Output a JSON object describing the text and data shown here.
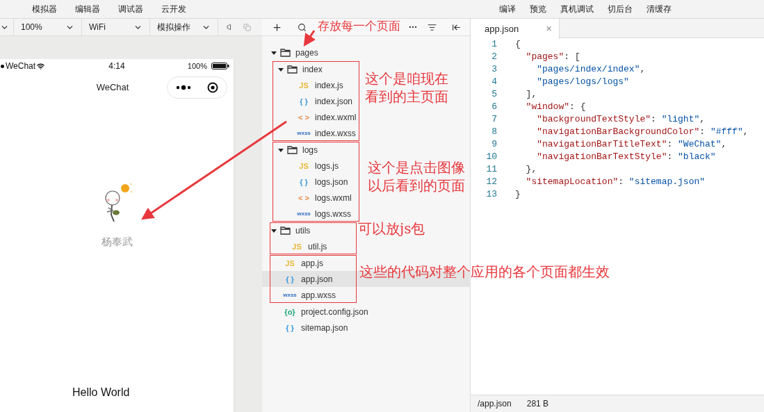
{
  "menu": {
    "left": [
      "模拟器",
      "编辑器",
      "调试器",
      "云开发"
    ],
    "right": [
      "编译",
      "预览",
      "真机调试",
      "切后台",
      "清缓存"
    ]
  },
  "simulator_toolbar": {
    "dropdowns": [
      "100%",
      "WiFi",
      "模拟操作"
    ]
  },
  "phone": {
    "carrier": "WeChat",
    "time": "4:14",
    "battery": "100%",
    "title": "WeChat",
    "username": "杨奉武",
    "greeting": "Hello World"
  },
  "callout": "存放每一个页面",
  "tree": [
    {
      "kind": "folder",
      "name": "pages",
      "expanded": true,
      "boxed": false,
      "children": [
        {
          "kind": "folder",
          "name": "index",
          "expanded": true,
          "boxed": true,
          "note": [
            "这个是咱现在",
            "看到的主页面"
          ],
          "children": [
            {
              "kind": "js",
              "icon": "JS",
              "name": "index.js",
              "selected": false
            },
            {
              "kind": "json",
              "icon": "{ }",
              "name": "index.json",
              "selected": false
            },
            {
              "kind": "wxml",
              "icon": "< >",
              "name": "index.wxml",
              "selected": false
            },
            {
              "kind": "wxss",
              "icon": "wxss",
              "name": "index.wxss",
              "selected": false
            }
          ]
        },
        {
          "kind": "folder",
          "name": "logs",
          "expanded": true,
          "boxed": true,
          "note": [
            "这个是点击图像",
            "以后看到的页面"
          ],
          "children": [
            {
              "kind": "js",
              "icon": "JS",
              "name": "logs.js",
              "selected": false
            },
            {
              "kind": "json",
              "icon": "{ }",
              "name": "logs.json",
              "selected": false
            },
            {
              "kind": "wxml",
              "icon": "< >",
              "name": "logs.wxml",
              "selected": false
            },
            {
              "kind": "wxss",
              "icon": "wxss",
              "name": "logs.wxss",
              "selected": false
            }
          ]
        }
      ]
    },
    {
      "kind": "folder",
      "name": "utils",
      "expanded": true,
      "boxed": true,
      "note": [
        "可以放js包"
      ],
      "children": [
        {
          "kind": "js",
          "icon": "JS",
          "name": "util.js",
          "selected": false
        }
      ]
    },
    {
      "kind": "group",
      "boxed": true,
      "note": [
        "这些的代码对整个应用的各个页面都生效"
      ],
      "children": [
        {
          "kind": "js",
          "icon": "JS",
          "name": "app.js",
          "selected": false
        },
        {
          "kind": "json",
          "icon": "{ }",
          "name": "app.json",
          "selected": true
        },
        {
          "kind": "wxss",
          "icon": "wxss",
          "name": "app.wxss",
          "selected": false
        }
      ]
    },
    {
      "kind": "config",
      "icon": "{o}",
      "name": "project.config.json",
      "selected": false
    },
    {
      "kind": "json",
      "icon": "{ }",
      "name": "sitemap.json",
      "selected": false
    }
  ],
  "editor": {
    "tab": {
      "title": "app.json",
      "close": "×"
    },
    "lines": [
      {
        "number": "1",
        "code": "{"
      },
      {
        "number": "2",
        "code": "  \"pages\": ["
      },
      {
        "number": "3",
        "code": "    \"pages/index/index\","
      },
      {
        "number": "4",
        "code": "    \"pages/logs/logs\""
      },
      {
        "number": "5",
        "code": "  ],"
      },
      {
        "number": "6",
        "code": "  \"window\": {"
      },
      {
        "number": "7",
        "code": "    \"backgroundTextStyle\": \"light\","
      },
      {
        "number": "8",
        "code": "    \"navigationBarBackgroundColor\": \"#fff\","
      },
      {
        "number": "9",
        "code": "    \"navigationBarTitleText\": \"WeChat\","
      },
      {
        "number": "10",
        "code": "    \"navigationBarTextStyle\": \"black\""
      },
      {
        "number": "11",
        "code": "  },"
      },
      {
        "number": "12",
        "code": "  \"sitemapLocation\": \"sitemap.json\""
      },
      {
        "number": "13",
        "code": "}"
      }
    ],
    "status": {
      "path": "/app.json",
      "size": "281 B"
    }
  }
}
